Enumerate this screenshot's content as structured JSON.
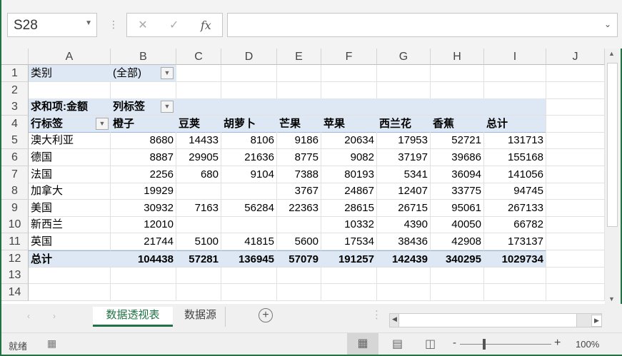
{
  "formula_bar": {
    "name_box": "S28",
    "cancel_icon": "✕",
    "enter_icon": "✓",
    "fx_label": "fx",
    "formula": ""
  },
  "columns": [
    "A",
    "B",
    "C",
    "D",
    "E",
    "F",
    "G",
    "H",
    "I",
    "J"
  ],
  "rows": [
    "1",
    "2",
    "3",
    "4",
    "5",
    "6",
    "7",
    "8",
    "9",
    "10",
    "11",
    "12",
    "13",
    "14"
  ],
  "pivot": {
    "filter_label": "类别",
    "filter_value": "(全部)",
    "values_label": "求和项:金额",
    "col_labels": "列标签",
    "row_labels": "行标签",
    "headers": [
      "橙子",
      "豆荚",
      "胡萝卜",
      "芒果",
      "苹果",
      "西兰花",
      "香蕉",
      "总计"
    ],
    "data": [
      [
        "澳大利亚",
        "8680",
        "14433",
        "8106",
        "9186",
        "20634",
        "17953",
        "52721",
        "131713"
      ],
      [
        "德国",
        "8887",
        "29905",
        "21636",
        "8775",
        "9082",
        "37197",
        "39686",
        "155168"
      ],
      [
        "法国",
        "2256",
        "680",
        "9104",
        "7388",
        "80193",
        "5341",
        "36094",
        "141056"
      ],
      [
        "加拿大",
        "19929",
        "",
        "",
        "3767",
        "24867",
        "12407",
        "33775",
        "94745"
      ],
      [
        "美国",
        "30932",
        "7163",
        "56284",
        "22363",
        "28615",
        "26715",
        "95061",
        "267133"
      ],
      [
        "新西兰",
        "12010",
        "",
        "",
        "",
        "10332",
        "4390",
        "40050",
        "66782"
      ],
      [
        "英国",
        "21744",
        "5100",
        "41815",
        "5600",
        "17534",
        "38436",
        "42908",
        "173137"
      ]
    ],
    "total": [
      "总计",
      "104438",
      "57281",
      "136945",
      "57079",
      "191257",
      "142439",
      "340295",
      "1029734"
    ]
  },
  "sheets": [
    {
      "label": "数据透视表",
      "active": true
    },
    {
      "label": "数据源",
      "active": false
    }
  ],
  "status": {
    "ready": "就绪",
    "zoom": "100%",
    "zoom_level": 100
  }
}
